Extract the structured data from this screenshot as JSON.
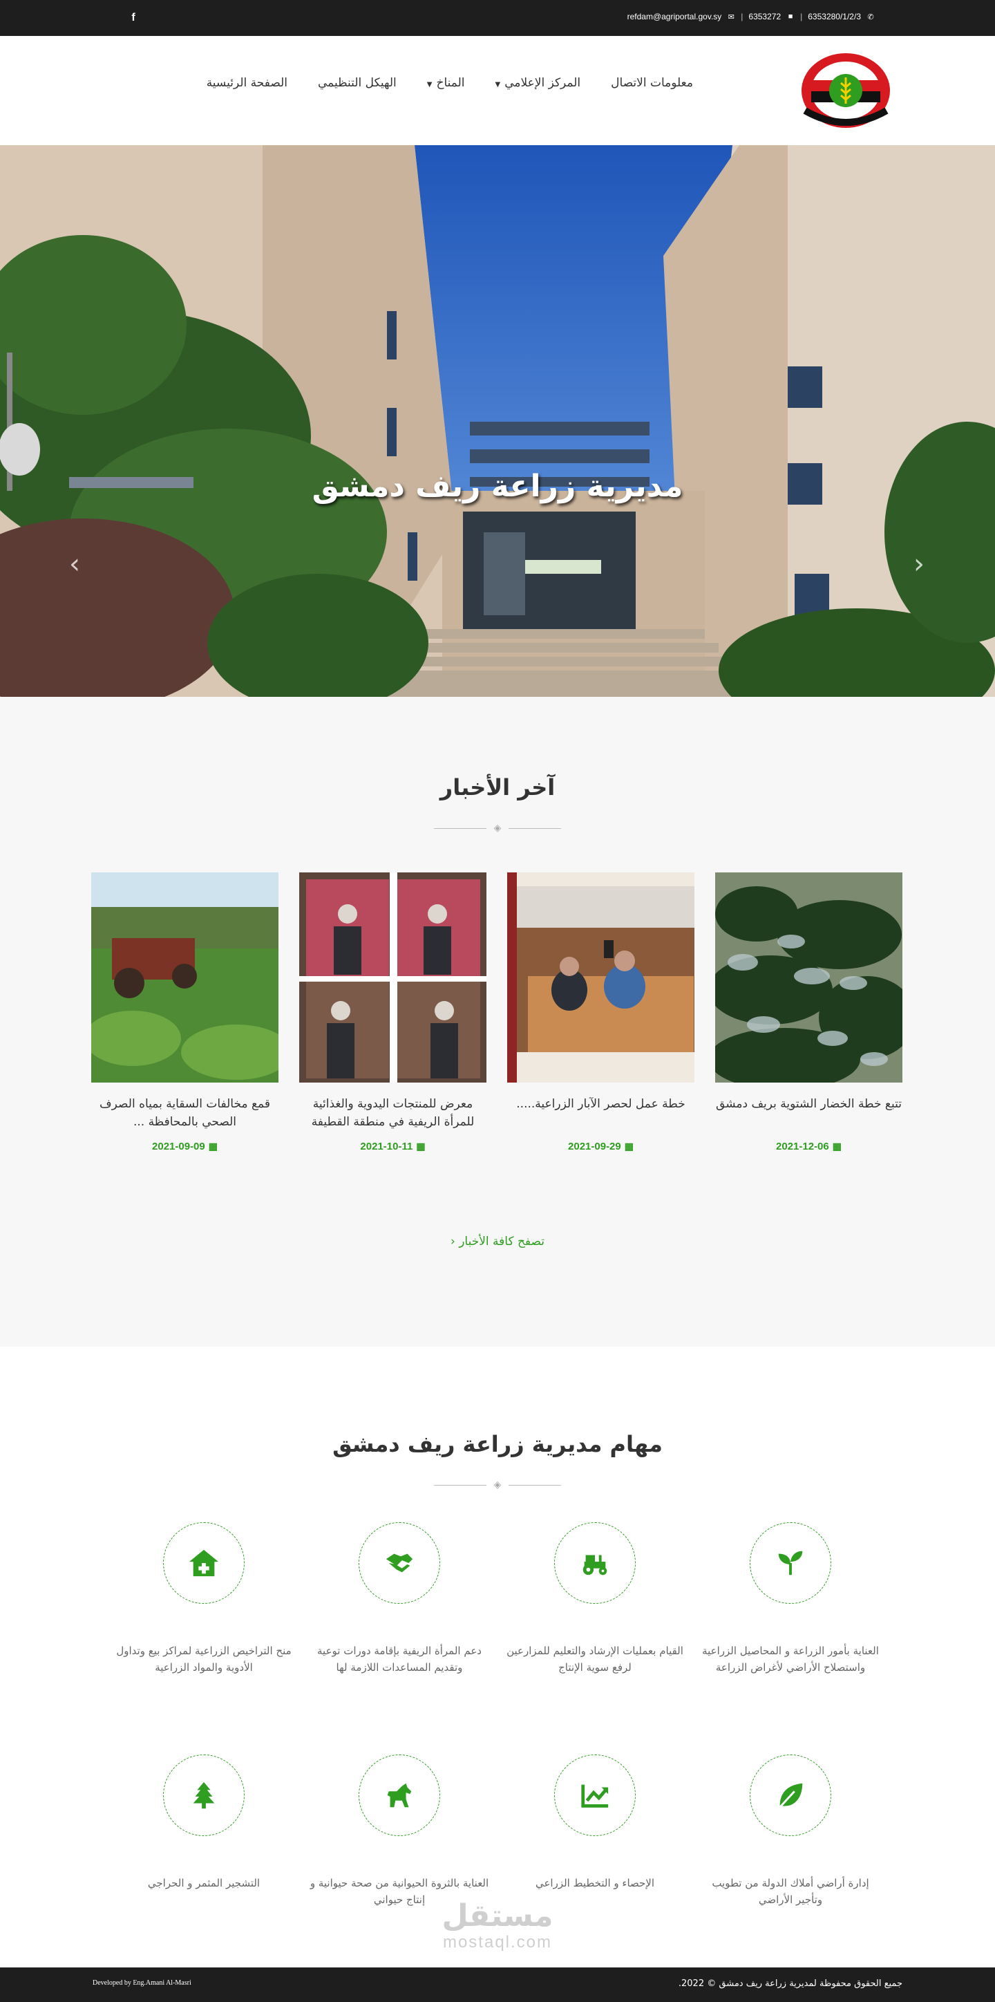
{
  "topbar": {
    "phone": "6353280/1/2/3",
    "fax": "6353272",
    "email": "refdam@agriportal.gov.sy",
    "separator": "|",
    "icons": {
      "phone": "phone-icon",
      "fax": "fax-icon",
      "email": "envelope-icon",
      "social": "facebook-icon"
    },
    "facebook_glyph": "f"
  },
  "nav": {
    "items": [
      {
        "label": "الصفحة الرئيسية"
      },
      {
        "label": "الهيكل التنظيمي"
      },
      {
        "label": "المناخ",
        "dropdown": true
      },
      {
        "label": "المركز الإعلامي",
        "dropdown": true
      },
      {
        "label": "معلومات الاتصال"
      }
    ]
  },
  "hero": {
    "caption": "مديرية زراعة ريف دمشق",
    "prev_glyph": "‹",
    "next_glyph": "›"
  },
  "news": {
    "title": "آخر الأخبار",
    "items": [
      {
        "title": "تتبع خطة الخضار الشتوية بريف دمشق",
        "date": "2021-12-06"
      },
      {
        "title": "خطة عمل لحصر الآبار الزراعية.....",
        "date": "2021-09-29"
      },
      {
        "title": "معرض للمنتجات اليدوية والغذائية للمرأة الريفية في منطقة القطيفة",
        "date": "2021-10-11"
      },
      {
        "title": "قمع مخالفات السقاية بمياه الصرف الصحي بالمحافظة ...",
        "date": "2021-09-09"
      }
    ],
    "browse_label": "تصفح كافة الأخبار",
    "browse_glyph": "‹"
  },
  "tasks": {
    "title": "مهام مديرية زراعة ريف دمشق",
    "items": [
      {
        "text": "العناية بأمور الزراعة و المحاصيل الزراعية واستصلاح الأراضي لأغراض الزراعة",
        "icon": "seedling-icon"
      },
      {
        "text": "القيام بعمليات الإرشاد والتعليم للمزارعين لرفع سوية الإنتاج",
        "icon": "tractor-icon"
      },
      {
        "text": "دعم المرأة الريفية بإقامة دورات توعية وتقديم المساعدات اللازمة لها",
        "icon": "handshake-icon"
      },
      {
        "text": "منح التراخيص الزراعية لمراكز بيع وتداول الأدوية والمواد الزراعية",
        "icon": "clinic-icon"
      },
      {
        "text": "إدارة أراضي أملاك الدولة من تطويب وتأجير الأراضي",
        "icon": "leaf-icon"
      },
      {
        "text": "الإحصاء و التخطيط الزراعي",
        "icon": "chart-line-icon"
      },
      {
        "text": "العناية بالثروة الحيوانية من صحة حيوانية و إنتاج حيواني",
        "icon": "horse-icon"
      },
      {
        "text": "التشجير المثمر و الحراجي",
        "icon": "tree-icon"
      }
    ]
  },
  "watermark": {
    "arabic": "مستقل",
    "latin": "mostaql.com"
  },
  "footer": {
    "developer": "Developed by Eng.Amani Al-Masri",
    "copyright": "جميع الحقوق محفوظة لمديرية زراعة ريف دمشق © 2022."
  },
  "colors": {
    "accent": "#2e9d20",
    "topbar": "#1e1e1e",
    "news_bg": "#f7f7f7"
  }
}
